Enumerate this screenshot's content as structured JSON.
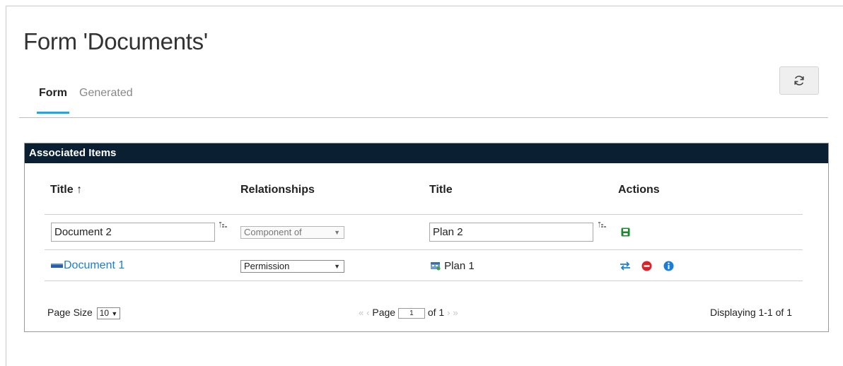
{
  "page": {
    "title": "Form 'Documents'"
  },
  "tabs": [
    {
      "label": "Form",
      "active": true
    },
    {
      "label": "Generated",
      "active": false
    }
  ],
  "toolbar": {
    "refresh_icon": "refresh-icon"
  },
  "panel": {
    "title": "Associated Items",
    "columns": {
      "title_left": "Title",
      "sort_indicator": "↑",
      "relationships": "Relationships",
      "title_right": "Title",
      "actions": "Actions"
    },
    "new_row": {
      "left_value": "Document 2",
      "relationship": "Component of",
      "right_value": "Plan 2"
    },
    "rows": [
      {
        "left_title": "Document 1",
        "relationship": "Permission",
        "right_title": "Plan 1"
      }
    ],
    "footer": {
      "page_size_label": "Page Size",
      "page_size_value": "10",
      "page_label": "Page",
      "page_value": "1",
      "of_label": "of 1",
      "displaying": "Displaying 1-1 of 1"
    }
  },
  "colors": {
    "accent": "#1ba9e1",
    "header_bg": "#0b1f33",
    "link": "#1a7ed6",
    "save_green": "#1a8a2e",
    "remove_red": "#d9232a",
    "info_blue": "#1a7ed6"
  }
}
